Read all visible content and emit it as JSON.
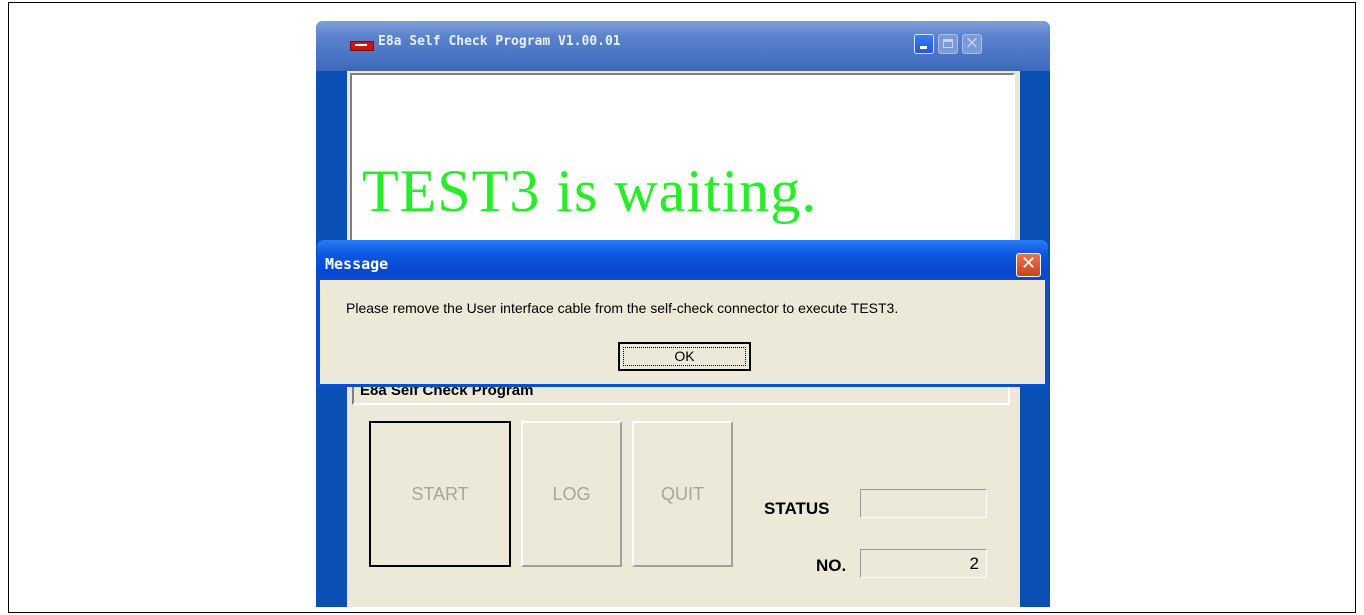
{
  "main_window": {
    "title": "E8a Self Check Program V1.00.01",
    "display_message": "TEST3 is waiting.",
    "program_label": "E8a Self Check Program",
    "buttons": {
      "start": "START",
      "log": "LOG",
      "quit": "QUIT"
    },
    "status_label": "STATUS",
    "status_value": "",
    "no_label": "NO.",
    "no_value": "2"
  },
  "dialog": {
    "title": "Message",
    "text": "Please remove the User interface cable from the self-check connector to execute TEST3.",
    "ok_label": "OK"
  },
  "icons": [
    "app-icon",
    "minimize-icon",
    "maximize-icon",
    "close-icon"
  ],
  "colors": {
    "display_text": "#26ee26",
    "window_bg": "#ece9d8",
    "titlebar_blue": "#0a4fb4",
    "close_red": "#d9532f"
  }
}
